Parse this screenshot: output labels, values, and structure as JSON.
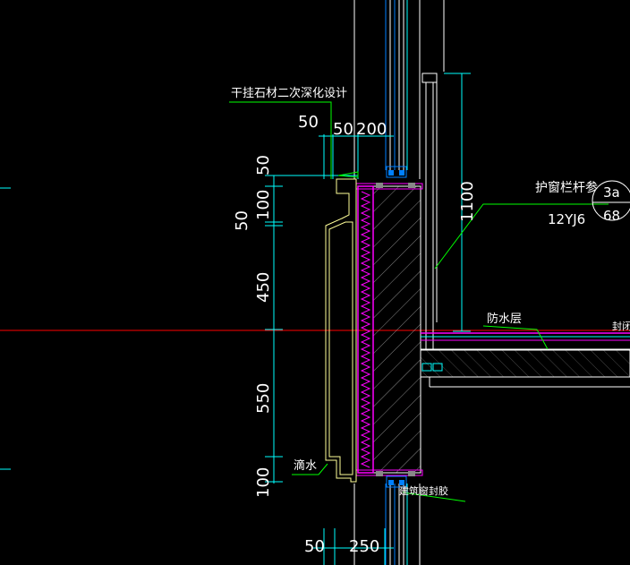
{
  "drawing": {
    "dimensions": {
      "top_left": "50",
      "top_mid": "50",
      "top_right": "200",
      "left_v_50_top": "50",
      "left_v_100_top": "100",
      "left_v_50_mid": "50",
      "left_v_450": "450",
      "left_v_550": "550",
      "left_v_100_bot": "100",
      "right_v_1100": "1100",
      "bottom_left": "50",
      "bottom_right": "250"
    },
    "annotations": {
      "stone_design": "干挂石材二次深化设计",
      "guardrail": "护窗栏杆参",
      "detail_ref_top": "3a",
      "detail_ref_bottom": "68",
      "atlas": "12YJ6",
      "waterproof": "防水层",
      "drip": "滴水",
      "sealant": "建筑窗封胶",
      "right_edge": "封闭"
    }
  },
  "colors": {
    "background": "#000000",
    "dim": "#00ffff",
    "leader": "#00ff00",
    "stone": "#ffff99",
    "insulation": "#ff00ff",
    "concrete": "#ffffff",
    "axis": "#ff0000",
    "window": "#0080ff",
    "text": "#ffffff"
  }
}
